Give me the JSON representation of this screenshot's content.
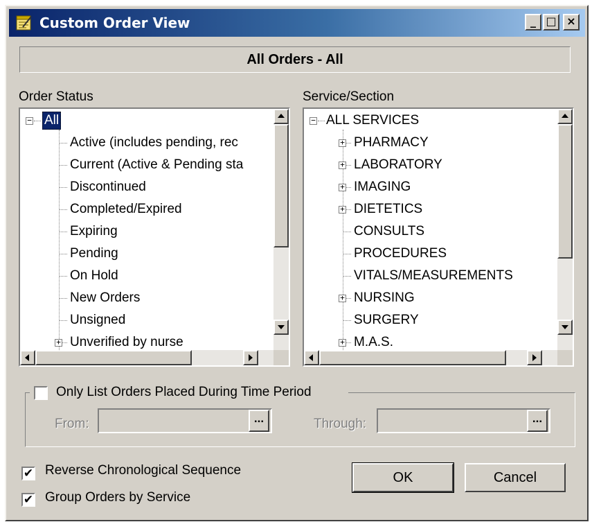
{
  "window": {
    "title": "Custom Order View",
    "minimize": "_",
    "maximize": "□",
    "close": "×"
  },
  "header": {
    "text": "All Orders - All"
  },
  "order_status": {
    "label": "Order Status",
    "root": "All",
    "items": [
      "Active (includes pending, rec",
      "Current (Active & Pending sta",
      "Discontinued",
      "Completed/Expired",
      "Expiring",
      "Pending",
      "On Hold",
      "New Orders",
      "Unsigned",
      "Unverified by nurse"
    ]
  },
  "service_section": {
    "label": "Service/Section",
    "root": "ALL SERVICES",
    "items": [
      {
        "label": "PHARMACY",
        "expandable": true
      },
      {
        "label": "LABORATORY",
        "expandable": true
      },
      {
        "label": "IMAGING",
        "expandable": true
      },
      {
        "label": "DIETETICS",
        "expandable": true
      },
      {
        "label": "CONSULTS",
        "expandable": false
      },
      {
        "label": "PROCEDURES",
        "expandable": false
      },
      {
        "label": "VITALS/MEASUREMENTS",
        "expandable": false
      },
      {
        "label": "NURSING",
        "expandable": true
      },
      {
        "label": "SURGERY",
        "expandable": false
      },
      {
        "label": "M.A.S.",
        "expandable": true
      }
    ]
  },
  "time_period": {
    "checkbox_label": "Only List Orders Placed During Time Period",
    "checked": false,
    "from_label": "From:",
    "from_value": "",
    "through_label": "Through:",
    "through_value": "",
    "ellipsis": "..."
  },
  "options": {
    "reverse_label": "Reverse Chronological Sequence",
    "reverse_checked": true,
    "group_label": "Group Orders by Service",
    "group_checked": true,
    "check_glyph": "✔"
  },
  "buttons": {
    "ok": "OK",
    "cancel": "Cancel"
  },
  "colors": {
    "title_start": "#0a246a",
    "title_end": "#a6caf0",
    "face": "#d4d0c8"
  }
}
